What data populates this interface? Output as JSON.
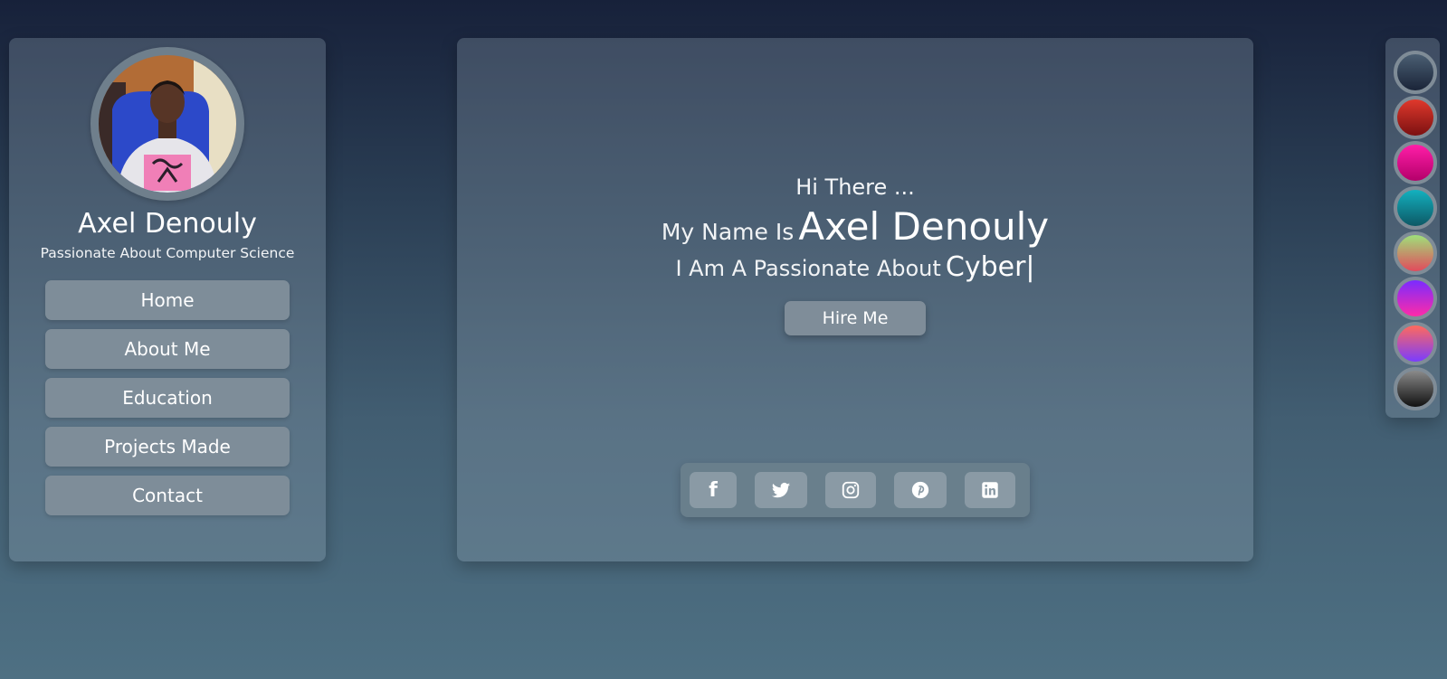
{
  "profile": {
    "name": "Axel Denouly",
    "tagline": "Passionate About Computer Science"
  },
  "nav": {
    "items": [
      "Home",
      "About Me",
      "Education",
      "Projects Made",
      "Contact"
    ]
  },
  "hero": {
    "greeting": "Hi There ...",
    "name_prefix": "My Name Is",
    "name": "Axel Denouly",
    "passion_prefix": "I Am A Passionate About",
    "typed_text": "Cyber",
    "cursor": "|",
    "hire_button": "Hire Me"
  },
  "social": [
    {
      "name": "facebook-icon",
      "glyph": "f"
    },
    {
      "name": "twitter-icon"
    },
    {
      "name": "instagram-icon"
    },
    {
      "name": "pinterest-icon"
    },
    {
      "name": "linkedin-icon",
      "glyph": "in"
    }
  ],
  "theme_swatches": [
    [
      "#4b5f73",
      "#1a2438"
    ],
    [
      "#e0392c",
      "#7b1111"
    ],
    [
      "#ff1ea8",
      "#b4006a"
    ],
    [
      "#13b1bf",
      "#0d5865"
    ],
    [
      "#9fe07a",
      "#e24a5c"
    ],
    [
      "#7a2bff",
      "#ff2ba8"
    ],
    [
      "#ff6a5c",
      "#7a3cff"
    ],
    [
      "#8a8a8a",
      "#111111"
    ]
  ]
}
